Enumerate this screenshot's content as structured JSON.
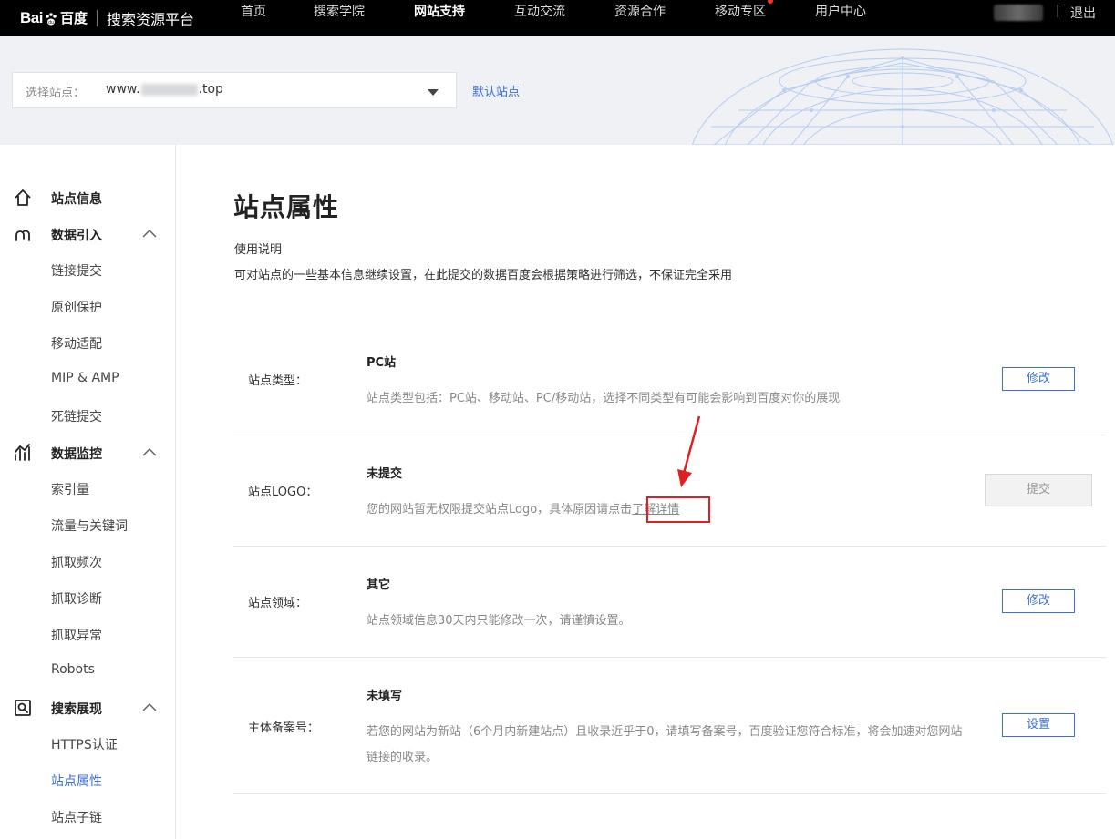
{
  "topbar": {
    "logo_word_left": "Bai",
    "logo_bd": "百度",
    "platform_title": "搜索资源平台",
    "nav": [
      {
        "label": "首页",
        "active": false
      },
      {
        "label": "搜索学院",
        "active": false
      },
      {
        "label": "网站支持",
        "active": true
      },
      {
        "label": "互动交流",
        "active": false
      },
      {
        "label": "资源合作",
        "active": false
      },
      {
        "label": "移动专区",
        "active": false
      },
      {
        "label": "用户中心",
        "active": false
      }
    ],
    "separator": "|",
    "logout": "退出"
  },
  "site_selector": {
    "label": "选择站点：",
    "value_prefix": "www.",
    "value_suffix": ".top",
    "default_site_link": "默认站点"
  },
  "sidebar": {
    "site_info": "站点信息",
    "data_import": "数据引入",
    "data_import_items": [
      "链接提交",
      "原创保护",
      "移动适配",
      "MIP & AMP",
      "死链提交"
    ],
    "data_monitor": "数据监控",
    "data_monitor_items": [
      "索引量",
      "流量与关键词",
      "抓取频次",
      "抓取诊断",
      "抓取异常",
      "Robots"
    ],
    "search_display": "搜索展现",
    "search_display_items": [
      "HTTPS认证",
      "站点属性",
      "站点子链"
    ],
    "active_item": "站点属性"
  },
  "main": {
    "title": "站点属性",
    "usage_title": "使用说明",
    "usage_desc": "可对站点的一些基本信息继续设置，在此提交的数据百度会根据策略进行筛选，不保证完全采用",
    "rows": [
      {
        "label": "站点类型：",
        "value": "PC站",
        "desc": "站点类型包括：PC站、移动站、PC/移动站，选择不同类型有可能会影响到百度对你的展现",
        "button": "修改"
      },
      {
        "label": "站点LOGO：",
        "value": "未提交",
        "desc": "您的网站暂无权限提交站点Logo，具体原因请点击",
        "desc_link": "了解详情",
        "button": "提交"
      },
      {
        "label": "站点领域：",
        "value": "其它",
        "desc": "站点领域信息30天内只能修改一次，请谨慎设置。",
        "button": "修改"
      },
      {
        "label": "主体备案号：",
        "value": "未填写",
        "desc": "若您的网站为新站（6个月内新建站点）且收录近乎于0，请填写备案号，百度验证您符合标准，将会加速对您网站链接的收录。",
        "button": "设置"
      }
    ]
  },
  "colors": {
    "accent": "#3b6fd4",
    "topbar": "#000000",
    "highlight": "#e02020"
  }
}
